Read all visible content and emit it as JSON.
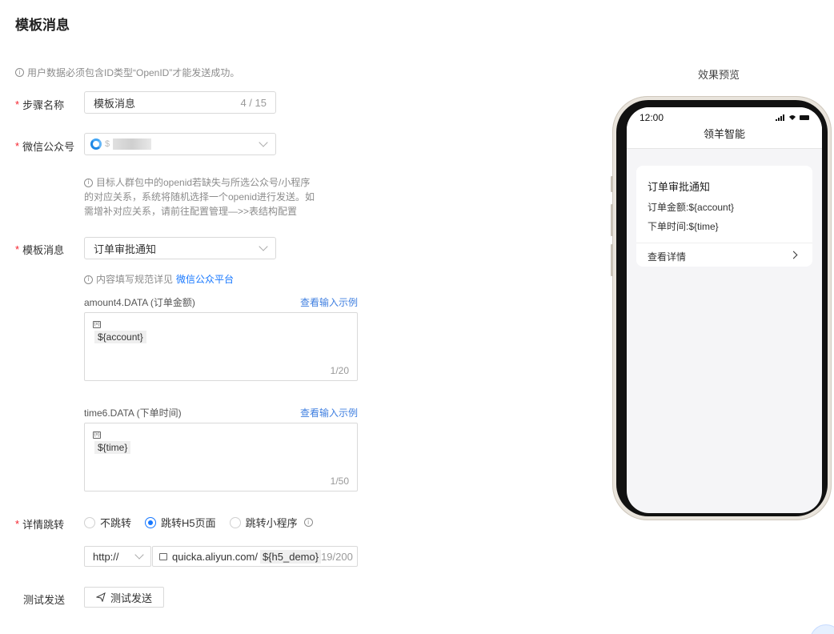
{
  "page": {
    "title": "模板消息"
  },
  "notice": {
    "icon": "info-icon",
    "text": "用户数据必须包含ID类型“OpenID”才能发送成功。"
  },
  "step_name": {
    "label": "步骤名称",
    "value": "模板消息",
    "counter": "4 / 15"
  },
  "wechat_account": {
    "label": "微信公众号",
    "value": "$"
  },
  "account_hint": {
    "lines": [
      "目标人群包中的openid若缺失与所选公众号/小程序",
      "的对应关系，系统将随机选择一个openid进行发送。如",
      "需增补对应关系，请前往配置管理—>>表结构配置"
    ]
  },
  "template": {
    "label": "模板消息",
    "value": "订单审批通知"
  },
  "template_hint": {
    "text": "内容填写规范详见",
    "link": "微信公众平台"
  },
  "fields": [
    {
      "name": "amount4.DATA (订单金额)",
      "example_link": "查看输入示例",
      "var": "${account}",
      "counter": "1/20"
    },
    {
      "name": "time6.DATA (下单时间)",
      "example_link": "查看输入示例",
      "var": "${time}",
      "counter": "1/50"
    }
  ],
  "detail_jump": {
    "label": "详情跳转",
    "options": [
      {
        "label": "不跳转",
        "checked": false
      },
      {
        "label": "跳转H5页面",
        "checked": true
      },
      {
        "label": "跳转小程序",
        "checked": false
      }
    ],
    "protocol": "http://",
    "url_text": "quicka.aliyun.com/",
    "url_var": "${h5_demo}",
    "url_counter": "19/200"
  },
  "test_send": {
    "label": "测试发送",
    "button": "测试发送"
  },
  "preview": {
    "label": "效果预览",
    "time": "12:00",
    "app_title": "领羊智能",
    "card_title": "订单审批通知",
    "lines": [
      "订单金额:${account}",
      "下单时间:${time}"
    ],
    "link": "查看详情"
  }
}
